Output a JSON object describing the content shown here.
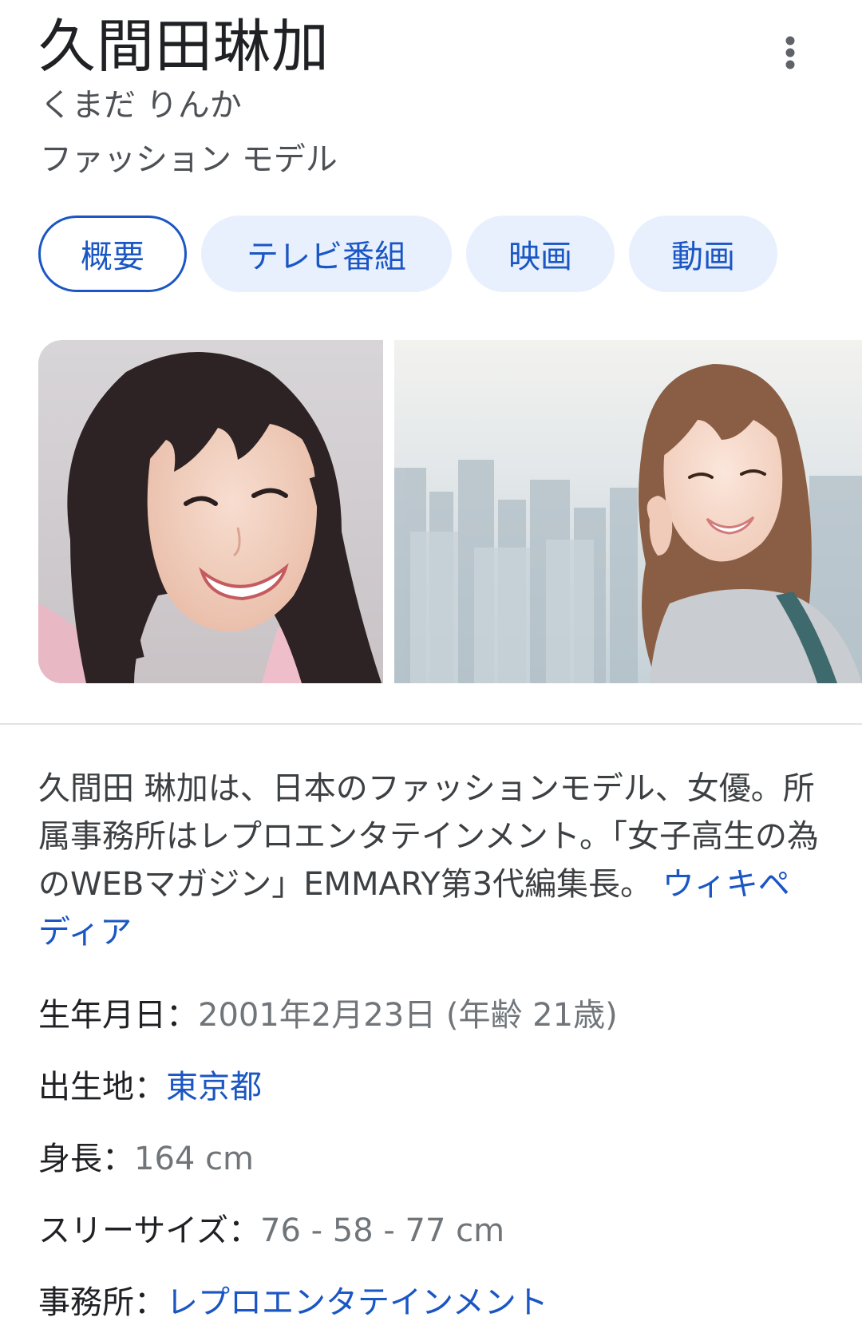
{
  "header": {
    "name": "久間田琳加",
    "reading": "くまだ りんか",
    "occupation": "ファッション モデル"
  },
  "tabs": [
    {
      "label": "概要",
      "active": true
    },
    {
      "label": "テレビ番組",
      "active": false
    },
    {
      "label": "映画",
      "active": false
    },
    {
      "label": "動画",
      "active": false
    }
  ],
  "description": {
    "text": "久間田 琳加は、日本のファッションモデル、女優。所属事務所はレプロエンタテインメント。「女子高生の為のWEBマガジン」EMMARY第3代編集長。",
    "source_link": "ウィキペディア"
  },
  "facts": {
    "birth": {
      "label": "生年月日：",
      "value": "2001年2月23日 (年齢 21歳)"
    },
    "birthplace": {
      "label": "出生地：",
      "value": "東京都"
    },
    "height": {
      "label": "身長：",
      "value": "164 cm"
    },
    "three_sizes": {
      "label": "スリーサイズ：",
      "value": "76 - 58 - 77 cm"
    },
    "agency": {
      "label": "事務所：",
      "value": "レプロエンタテインメント"
    }
  },
  "icons": {
    "more": "more-vert-icon"
  },
  "colors": {
    "link": "#1a56c4",
    "tab_bg": "#e8f0fe",
    "text_primary": "#202124",
    "text_secondary": "#70757a"
  }
}
